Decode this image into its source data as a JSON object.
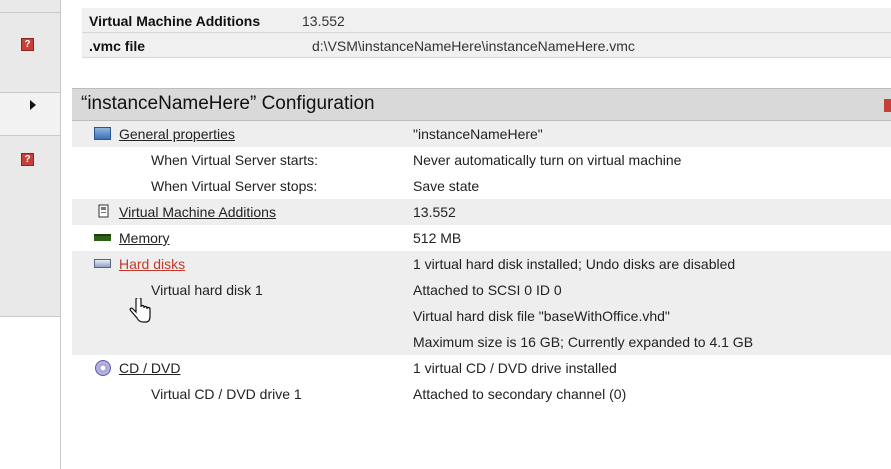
{
  "top_table": {
    "rows": [
      {
        "key": "Virtual Machine Additions",
        "value": "13.552"
      },
      {
        "key": ".vmc file",
        "value": "d:\\VSM\\instanceNameHere\\instanceNameHere.vmc"
      }
    ]
  },
  "configuration": {
    "title": "“instanceNameHere” Configuration",
    "rows": [
      {
        "label": "General properties",
        "value": "\"instanceNameHere\"",
        "icon": "general-properties-icon",
        "link": true
      },
      {
        "label": "When Virtual Server starts:",
        "value": "Never automatically turn on virtual machine"
      },
      {
        "label": "When Virtual Server stops:",
        "value": "Save state"
      },
      {
        "label": "Virtual Machine Additions",
        "value": "13.552",
        "icon": "additions-icon",
        "link": true
      },
      {
        "label": "Memory",
        "value": "512 MB",
        "icon": "memory-icon",
        "link": true
      },
      {
        "label": "Hard disks",
        "value": "1 virtual hard disk installed; Undo disks are disabled",
        "icon": "hard-disk-icon",
        "link": true
      },
      {
        "label": "Virtual hard disk 1",
        "value": "Attached to SCSI 0 ID 0"
      },
      {
        "label": "",
        "value": "Virtual hard disk file \"baseWithOffice.vhd\""
      },
      {
        "label": "",
        "value": "Maximum size is 16 GB; Currently expanded to 4.1 GB"
      },
      {
        "label": "CD / DVD",
        "value": "1 virtual CD / DVD drive installed",
        "icon": "cd-dvd-icon",
        "link": true
      },
      {
        "label": "Virtual CD / DVD drive 1",
        "value": "Attached to secondary channel (0)"
      }
    ]
  },
  "sidebar": {
    "help_icon_label": "?",
    "colors": {
      "help": "#c6403a"
    }
  }
}
